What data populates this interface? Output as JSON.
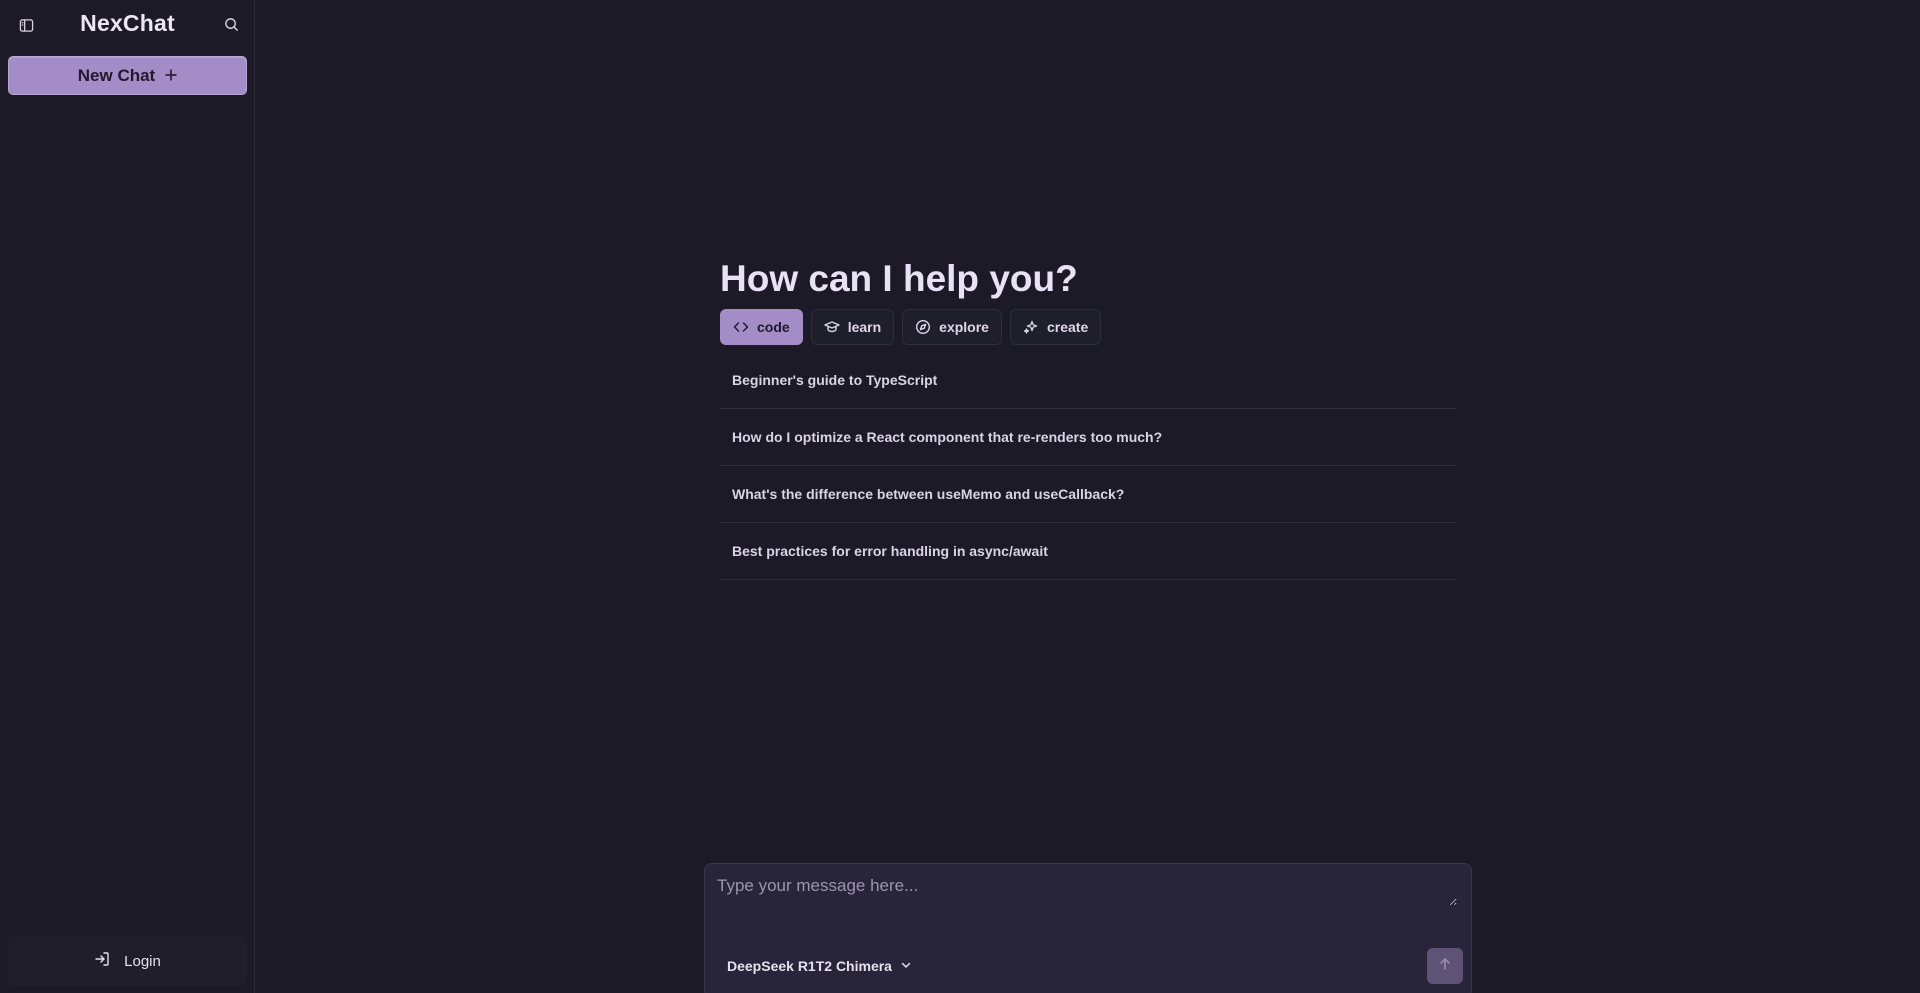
{
  "sidebar": {
    "title": "NexChat",
    "toggle_icon": "sidebar-toggle-icon",
    "search_icon": "search-icon",
    "new_chat_label": "New Chat",
    "new_chat_icon": "plus-icon",
    "login_label": "Login",
    "login_icon": "login-icon"
  },
  "main": {
    "heading": "How can I help you?",
    "categories": [
      {
        "label": "code",
        "icon": "code-icon",
        "active": true
      },
      {
        "label": "learn",
        "icon": "graduation-cap-icon",
        "active": false
      },
      {
        "label": "explore",
        "icon": "compass-icon",
        "active": false
      },
      {
        "label": "create",
        "icon": "sparkles-icon",
        "active": false
      }
    ],
    "suggestions": [
      "Beginner's guide to TypeScript",
      "How do I optimize a React component that re-renders too much?",
      "What's the difference between useMemo and useCallback?",
      "Best practices for error handling in async/await"
    ]
  },
  "composer": {
    "placeholder": "Type your message here...",
    "value": "",
    "model": "DeepSeek R1T2 Chimera",
    "model_icon": "chevron-down-icon",
    "send_icon": "arrow-up-icon"
  },
  "colors": {
    "background": "#1b1a26",
    "accent": "#a48dc6",
    "composer_bg": "#28253a",
    "send_button": "#5e5376"
  }
}
